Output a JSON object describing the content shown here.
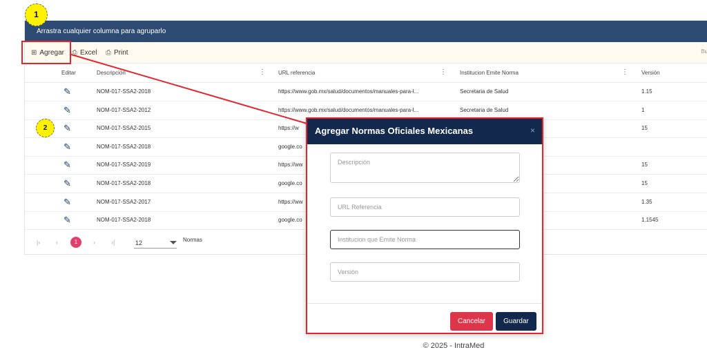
{
  "grid": {
    "group_bar_text": "Arrastra cualquier columna para agruparlo",
    "toolbar": {
      "add_label": "Agregar",
      "excel_label": "Excel",
      "print_label": "Print",
      "search_placeholder": "Bu"
    },
    "columns": [
      "Editar",
      "Descripción",
      "URL referencia",
      "Institucion Emite Norma",
      "Versión"
    ],
    "rows": [
      {
        "descripcion": "NOM-017-SSA2-2018",
        "url": "https://www.gob.mx/salud/documentos/manuales-para-l...",
        "institucion": "Secretaria de Salud",
        "version": "1.15"
      },
      {
        "descripcion": "NOM-017-SSA2-2012",
        "url": "https://www.gob.mx/salud/documentos/manuales-para-l...",
        "institucion": "Secretaria de Salud",
        "version": "1"
      },
      {
        "descripcion": "NOM-017-SSA2-2015",
        "url": "https://w",
        "institucion": "",
        "version": "15"
      },
      {
        "descripcion": "NOM-017-SSA2-2018",
        "url": "google.co",
        "institucion": "",
        "version": ""
      },
      {
        "descripcion": "NOM-017-SSA2-2019",
        "url": "https://ww",
        "institucion": "",
        "version": "15"
      },
      {
        "descripcion": "NOM-017-SSA2-2018",
        "url": "google.co",
        "institucion": "",
        "version": "15"
      },
      {
        "descripcion": "NOM-017-SSA2-2017",
        "url": "https://ww",
        "institucion": "",
        "version": "1.35"
      },
      {
        "descripcion": "NOM-017-SSA2-2018",
        "url": "google.co",
        "institucion": "",
        "version": "1.1545"
      }
    ],
    "pager": {
      "current_page": "1",
      "page_size": "12",
      "label": "Normas"
    }
  },
  "callouts": {
    "one": "1",
    "two": "2"
  },
  "modal": {
    "title": "Agregar Normas Oficiales Mexicanas",
    "close_glyph": "×",
    "fields": {
      "descripcion_placeholder": "Descripción",
      "url_placeholder": "URL Referencia",
      "institucion_placeholder": "Institucion que Emite Norma",
      "version_placeholder": "Versión"
    },
    "cancel_label": "Cancelar",
    "save_label": "Guardar"
  },
  "footer": {
    "text": "© 2025 - IntraMed"
  },
  "colors": {
    "header_bar": "#2c4a72",
    "modal_header": "#12294d",
    "cancel": "#dd3549",
    "highlight": "#e3262e",
    "callout": "#fff200"
  }
}
